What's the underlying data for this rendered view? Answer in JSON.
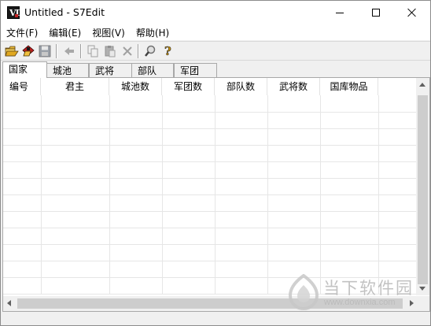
{
  "window": {
    "title": "Untitled - S7Edit",
    "app_icon_letter": "Ⅶ"
  },
  "menu": {
    "items": [
      {
        "label": "文件(F)"
      },
      {
        "label": "编辑(E)"
      },
      {
        "label": "视图(V)"
      },
      {
        "label": "帮助(H)"
      }
    ]
  },
  "toolbar": {
    "buttons": [
      {
        "icon": "open-folder-icon"
      },
      {
        "icon": "import-icon"
      },
      {
        "icon": "save-icon"
      },
      {
        "icon": "back-arrow-icon"
      },
      {
        "icon": "copy-icon"
      },
      {
        "icon": "paste-icon"
      },
      {
        "icon": "delete-icon"
      },
      {
        "icon": "find-icon"
      },
      {
        "icon": "help-icon"
      }
    ]
  },
  "tabs": {
    "items": [
      {
        "label": "国家",
        "active": true
      },
      {
        "label": "城池",
        "active": false
      },
      {
        "label": "武将",
        "active": false
      },
      {
        "label": "部队",
        "active": false
      },
      {
        "label": "军团",
        "active": false
      }
    ]
  },
  "table": {
    "columns": [
      {
        "label": "编号"
      },
      {
        "label": "君主"
      },
      {
        "label": "城池数"
      },
      {
        "label": "军团数"
      },
      {
        "label": "部队数"
      },
      {
        "label": "武将数"
      },
      {
        "label": "国库物品"
      }
    ],
    "rows": []
  },
  "watermark": {
    "title": "当下软件园",
    "url": "www.downxia.com"
  },
  "colors": {
    "window_bg": "#f0f0f0",
    "grid_line": "#e2e2e2",
    "watermark": "#b8b8b8"
  }
}
